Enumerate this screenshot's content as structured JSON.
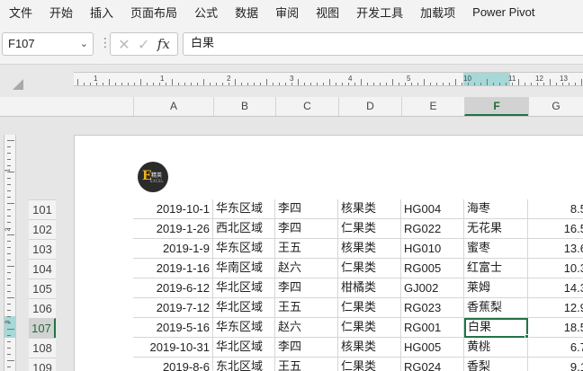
{
  "menu": [
    "文件",
    "开始",
    "插入",
    "页面布局",
    "公式",
    "数据",
    "审阅",
    "视图",
    "开发工具",
    "加载项",
    "Power Pivot"
  ],
  "formula_bar": {
    "name_box": "F107",
    "name_box_chevron": "chevron-down-icon",
    "separator": "⋮",
    "cancel_glyph": "✕",
    "enter_glyph": "✓",
    "fx_glyph": "fx",
    "formula_value": "白果"
  },
  "ruler": {
    "labels": [
      "1",
      "1",
      "2",
      "3",
      "4",
      "5",
      "6",
      "7",
      "8",
      "9",
      "10",
      "11",
      "12",
      "13"
    ]
  },
  "vruler": {
    "labels": [
      "1",
      "2",
      "3"
    ]
  },
  "columns": [
    "A",
    "B",
    "C",
    "D",
    "E",
    "F",
    "G"
  ],
  "selected_column": "F",
  "selected_row": "107",
  "rows": [
    {
      "num": "101",
      "date": "2019-10-1",
      "region": "华东区域",
      "name": "李四",
      "category": "核果类",
      "code": "HG004",
      "product": "海枣",
      "value": "8.5"
    },
    {
      "num": "102",
      "date": "2019-1-26",
      "region": "西北区域",
      "name": "李四",
      "category": "仁果类",
      "code": "RG022",
      "product": "无花果",
      "value": "16.5"
    },
    {
      "num": "103",
      "date": "2019-1-9",
      "region": "华东区域",
      "name": "王五",
      "category": "核果类",
      "code": "HG010",
      "product": "蜜枣",
      "value": "13.6"
    },
    {
      "num": "104",
      "date": "2019-1-16",
      "region": "华南区域",
      "name": "赵六",
      "category": "仁果类",
      "code": "RG005",
      "product": "红富士",
      "value": "10.3"
    },
    {
      "num": "105",
      "date": "2019-6-12",
      "region": "华北区域",
      "name": "李四",
      "category": "柑橘类",
      "code": "GJ002",
      "product": "莱姆",
      "value": "14.3"
    },
    {
      "num": "106",
      "date": "2019-7-12",
      "region": "华北区域",
      "name": "王五",
      "category": "仁果类",
      "code": "RG023",
      "product": "香蕉梨",
      "value": "12.9"
    },
    {
      "num": "107",
      "date": "2019-5-16",
      "region": "华东区域",
      "name": "赵六",
      "category": "仁果类",
      "code": "RG001",
      "product": "白果",
      "value": "18.5"
    },
    {
      "num": "108",
      "date": "2019-10-31",
      "region": "华北区域",
      "name": "李四",
      "category": "核果类",
      "code": "HG005",
      "product": "黄桃",
      "value": "6.7"
    },
    {
      "num": "109",
      "date": "2019-8-6",
      "region": "东北区域",
      "name": "王五",
      "category": "仁果类",
      "code": "RG024",
      "product": "香梨",
      "value": "9.1"
    }
  ],
  "logo": {
    "letter": "E",
    "text": "精英",
    "sub": "EXCEL"
  },
  "colors": {
    "accent": "#217346",
    "ruler_highlight": "#a6d8d8"
  }
}
